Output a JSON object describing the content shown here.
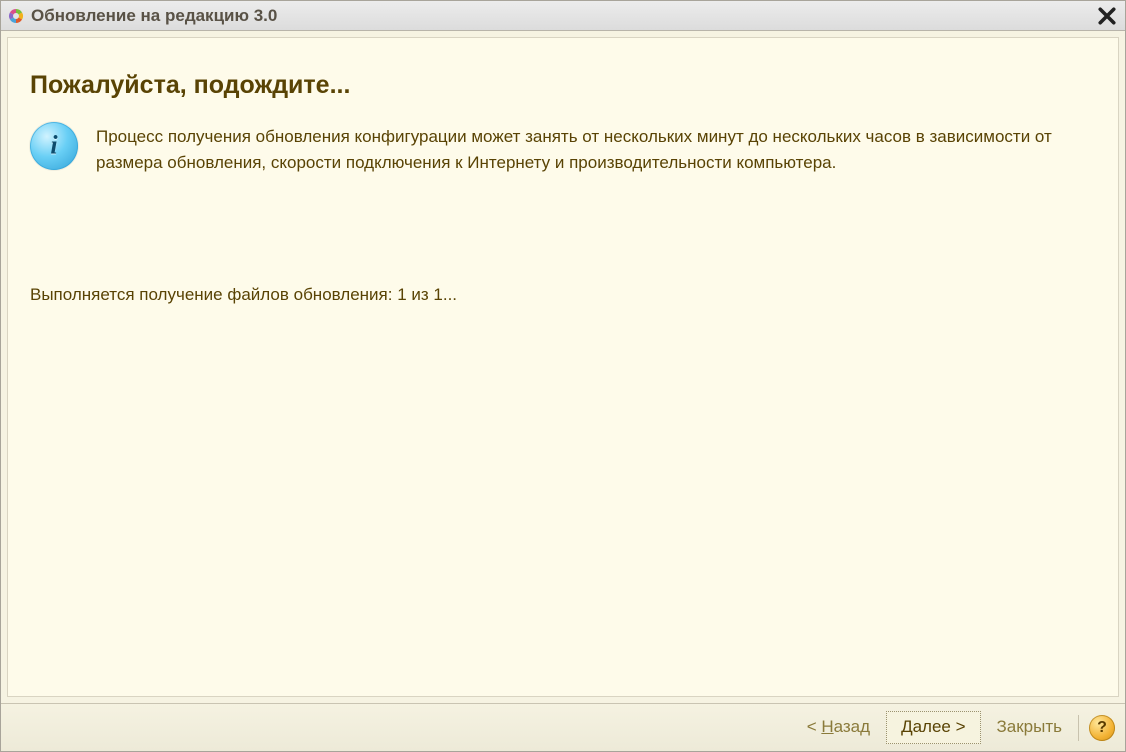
{
  "window": {
    "title": "Обновление на редакцию 3.0"
  },
  "page": {
    "heading": "Пожалуйста, подождите...",
    "info_text": "Процесс получения обновления конфигурации может занять от нескольких минут до нескольких часов в зависимости от размера обновления, скорости подключения к Интернету и производительности компьютера.",
    "status_text": "Выполняется получение файлов обновления: 1 из 1..."
  },
  "footer": {
    "back_prefix": "< ",
    "back_underline": "Н",
    "back_rest": "азад",
    "next_underline": "Д",
    "next_rest": "алее >",
    "close_label": "Закрыть",
    "help_label": "?"
  }
}
